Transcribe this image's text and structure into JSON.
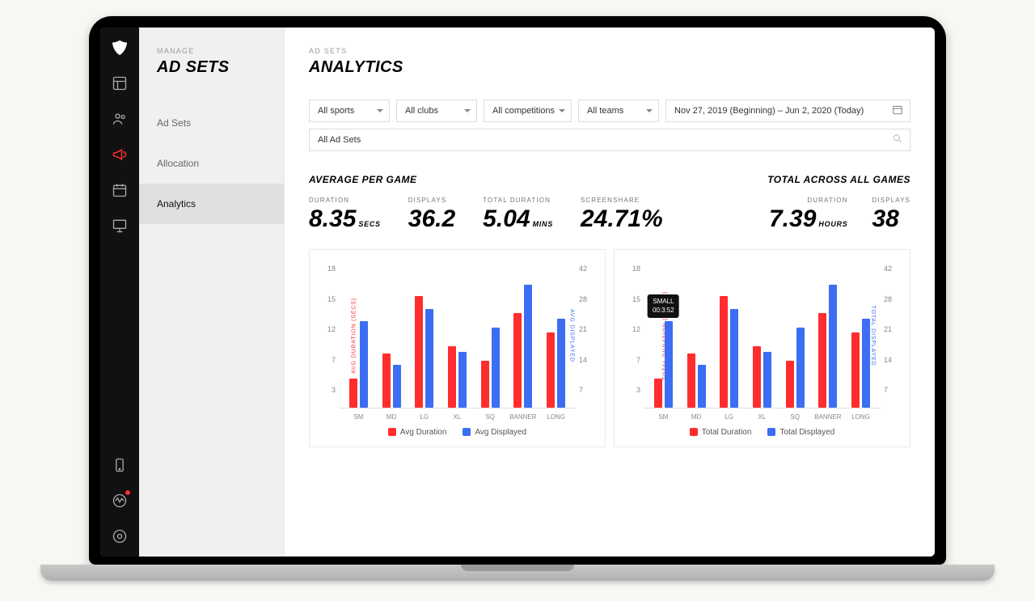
{
  "rail": {
    "logo": "eagle-logo"
  },
  "subnav": {
    "eyebrow": "MANAGE",
    "title": "AD SETS",
    "items": [
      "Ad Sets",
      "Allocation",
      "Analytics"
    ],
    "active_index": 2
  },
  "page": {
    "eyebrow": "AD SETS",
    "title": "ANALYTICS"
  },
  "filters": {
    "sport": "All sports",
    "club": "All clubs",
    "competition": "All competitions",
    "team": "All teams",
    "daterange": "Nov 27, 2019 (Beginning) – Jun 2, 2020 (Today)",
    "adsets": "All Ad Sets"
  },
  "stats": {
    "avg_head": "AVERAGE PER GAME",
    "total_head": "TOTAL ACROSS ALL GAMES",
    "avg": {
      "duration": {
        "label": "DURATION",
        "value": "8.35",
        "unit": "SECS"
      },
      "displays": {
        "label": "DISPLAYS",
        "value": "36.2",
        "unit": ""
      },
      "totaldur": {
        "label": "TOTAL DURATION",
        "value": "5.04",
        "unit": "MINS"
      },
      "screenshare": {
        "label": "SCREENSHARE",
        "value": "24.71%",
        "unit": ""
      }
    },
    "total": {
      "duration": {
        "label": "DURATION",
        "value": "7.39",
        "unit": "HOURS"
      },
      "displays": {
        "label": "DISPLAYS",
        "value": "38",
        "unit": ""
      }
    }
  },
  "chart_data": [
    {
      "type": "bar",
      "categories": [
        "SM",
        "MD",
        "LG",
        "XL",
        "SQ",
        "BANNER",
        "LONG"
      ],
      "series": [
        {
          "name": "Avg Duration",
          "values": [
            4.0,
            7.5,
            15.5,
            8.5,
            6.5,
            13.2,
            10.5
          ]
        },
        {
          "name": "Avg Displayed",
          "values": [
            28,
            14,
            32,
            18,
            26,
            40,
            29
          ]
        }
      ],
      "y_left": {
        "label": "AVG DURATION (SECS)",
        "lim": [
          0,
          18
        ],
        "ticks": [
          3,
          7,
          12,
          15,
          18
        ],
        "color": "#ff2d2d"
      },
      "y_right": {
        "label": "AVG DISPLAYED",
        "lim": [
          0,
          42
        ],
        "ticks": [
          7,
          14,
          21,
          28,
          42
        ],
        "color": "#3b6ef2"
      },
      "legend": [
        "Avg Duration",
        "Avg Displayed"
      ]
    },
    {
      "type": "bar",
      "categories": [
        "SM",
        "MD",
        "LG",
        "XL",
        "SQ",
        "BANNER",
        "LONG"
      ],
      "series": [
        {
          "name": "Total Duration",
          "values": [
            4.0,
            7.5,
            15.5,
            8.5,
            6.5,
            13.2,
            10.5
          ]
        },
        {
          "name": "Total Displayed",
          "values": [
            28,
            14,
            32,
            18,
            26,
            40,
            29
          ]
        }
      ],
      "y_left": {
        "label": "TOTAL DURATION (HOURS)",
        "lim": [
          0,
          18
        ],
        "ticks": [
          3,
          7,
          12,
          15,
          18
        ],
        "color": "#ff2d2d"
      },
      "y_right": {
        "label": "TOTAL DISPLAYED",
        "lim": [
          0,
          42
        ],
        "ticks": [
          7,
          14,
          21,
          28,
          42
        ],
        "color": "#3b6ef2"
      },
      "legend": [
        "Total Duration",
        "Total Displayed"
      ],
      "tooltip": {
        "category_index": 0,
        "title": "SMALL",
        "value": "00:3:52"
      }
    }
  ]
}
